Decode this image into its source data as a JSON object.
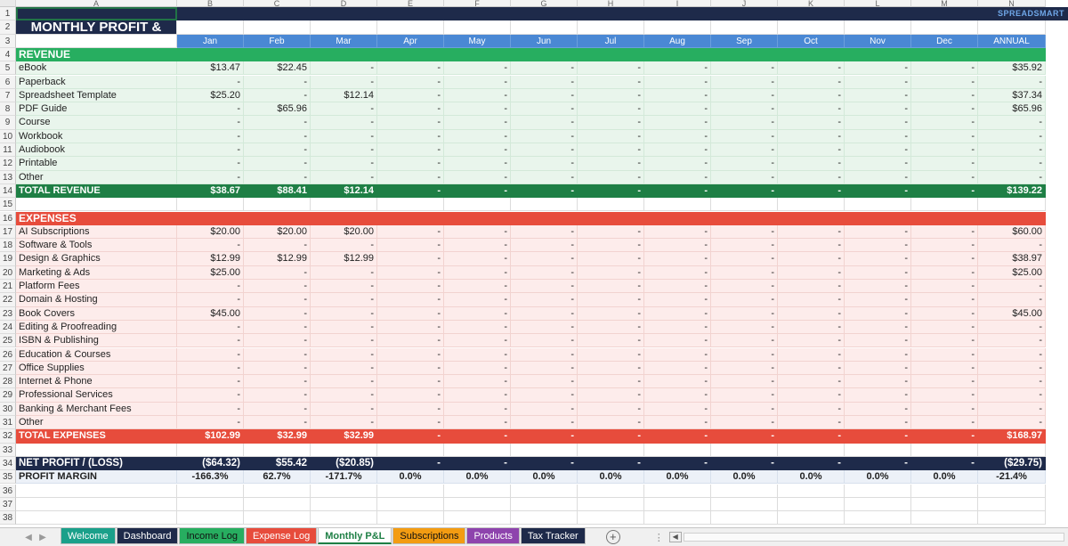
{
  "brand": "SPREADSMART",
  "title": "MONTHLY PROFIT &",
  "column_letters": [
    "A",
    "B",
    "C",
    "D",
    "E",
    "F",
    "G",
    "H",
    "I",
    "J",
    "K",
    "L",
    "M",
    "N"
  ],
  "months": [
    "Jan",
    "Feb",
    "Mar",
    "Apr",
    "May",
    "Jun",
    "Jul",
    "Aug",
    "Sep",
    "Oct",
    "Nov",
    "Dec",
    "ANNUAL"
  ],
  "revenue": {
    "header": "REVENUE",
    "items": [
      {
        "label": "eBook",
        "values": [
          "$13.47",
          "$22.45",
          "-",
          "-",
          "-",
          "-",
          "-",
          "-",
          "-",
          "-",
          "-",
          "-",
          "$35.92"
        ]
      },
      {
        "label": "Paperback",
        "values": [
          "-",
          "-",
          "-",
          "-",
          "-",
          "-",
          "-",
          "-",
          "-",
          "-",
          "-",
          "-",
          "-"
        ]
      },
      {
        "label": "Spreadsheet Template",
        "values": [
          "$25.20",
          "-",
          "$12.14",
          "-",
          "-",
          "-",
          "-",
          "-",
          "-",
          "-",
          "-",
          "-",
          "$37.34"
        ]
      },
      {
        "label": "PDF Guide",
        "values": [
          "-",
          "$65.96",
          "-",
          "-",
          "-",
          "-",
          "-",
          "-",
          "-",
          "-",
          "-",
          "-",
          "$65.96"
        ]
      },
      {
        "label": "Course",
        "values": [
          "-",
          "-",
          "-",
          "-",
          "-",
          "-",
          "-",
          "-",
          "-",
          "-",
          "-",
          "-",
          "-"
        ]
      },
      {
        "label": "Workbook",
        "values": [
          "-",
          "-",
          "-",
          "-",
          "-",
          "-",
          "-",
          "-",
          "-",
          "-",
          "-",
          "-",
          "-"
        ]
      },
      {
        "label": "Audiobook",
        "values": [
          "-",
          "-",
          "-",
          "-",
          "-",
          "-",
          "-",
          "-",
          "-",
          "-",
          "-",
          "-",
          "-"
        ]
      },
      {
        "label": "Printable",
        "values": [
          "-",
          "-",
          "-",
          "-",
          "-",
          "-",
          "-",
          "-",
          "-",
          "-",
          "-",
          "-",
          "-"
        ]
      },
      {
        "label": "Other",
        "values": [
          "-",
          "-",
          "-",
          "-",
          "-",
          "-",
          "-",
          "-",
          "-",
          "-",
          "-",
          "-",
          "-"
        ]
      }
    ],
    "total": {
      "label": "TOTAL REVENUE",
      "values": [
        "$38.67",
        "$88.41",
        "$12.14",
        "-",
        "-",
        "-",
        "-",
        "-",
        "-",
        "-",
        "-",
        "-",
        "$139.22"
      ]
    }
  },
  "expenses": {
    "header": "EXPENSES",
    "items": [
      {
        "label": "AI Subscriptions",
        "values": [
          "$20.00",
          "$20.00",
          "$20.00",
          "-",
          "-",
          "-",
          "-",
          "-",
          "-",
          "-",
          "-",
          "-",
          "$60.00"
        ]
      },
      {
        "label": "Software & Tools",
        "values": [
          "-",
          "-",
          "-",
          "-",
          "-",
          "-",
          "-",
          "-",
          "-",
          "-",
          "-",
          "-",
          "-"
        ]
      },
      {
        "label": "Design & Graphics",
        "values": [
          "$12.99",
          "$12.99",
          "$12.99",
          "-",
          "-",
          "-",
          "-",
          "-",
          "-",
          "-",
          "-",
          "-",
          "$38.97"
        ]
      },
      {
        "label": "Marketing & Ads",
        "values": [
          "$25.00",
          "-",
          "-",
          "-",
          "-",
          "-",
          "-",
          "-",
          "-",
          "-",
          "-",
          "-",
          "$25.00"
        ]
      },
      {
        "label": "Platform Fees",
        "values": [
          "-",
          "-",
          "-",
          "-",
          "-",
          "-",
          "-",
          "-",
          "-",
          "-",
          "-",
          "-",
          "-"
        ]
      },
      {
        "label": "Domain & Hosting",
        "values": [
          "-",
          "-",
          "-",
          "-",
          "-",
          "-",
          "-",
          "-",
          "-",
          "-",
          "-",
          "-",
          "-"
        ]
      },
      {
        "label": "Book Covers",
        "values": [
          "$45.00",
          "-",
          "-",
          "-",
          "-",
          "-",
          "-",
          "-",
          "-",
          "-",
          "-",
          "-",
          "$45.00"
        ]
      },
      {
        "label": "Editing & Proofreading",
        "values": [
          "-",
          "-",
          "-",
          "-",
          "-",
          "-",
          "-",
          "-",
          "-",
          "-",
          "-",
          "-",
          "-"
        ]
      },
      {
        "label": "ISBN & Publishing",
        "values": [
          "-",
          "-",
          "-",
          "-",
          "-",
          "-",
          "-",
          "-",
          "-",
          "-",
          "-",
          "-",
          "-"
        ]
      },
      {
        "label": "Education & Courses",
        "values": [
          "-",
          "-",
          "-",
          "-",
          "-",
          "-",
          "-",
          "-",
          "-",
          "-",
          "-",
          "-",
          "-"
        ]
      },
      {
        "label": "Office Supplies",
        "values": [
          "-",
          "-",
          "-",
          "-",
          "-",
          "-",
          "-",
          "-",
          "-",
          "-",
          "-",
          "-",
          "-"
        ]
      },
      {
        "label": "Internet & Phone",
        "values": [
          "-",
          "-",
          "-",
          "-",
          "-",
          "-",
          "-",
          "-",
          "-",
          "-",
          "-",
          "-",
          "-"
        ]
      },
      {
        "label": "Professional Services",
        "values": [
          "-",
          "-",
          "-",
          "-",
          "-",
          "-",
          "-",
          "-",
          "-",
          "-",
          "-",
          "-",
          "-"
        ]
      },
      {
        "label": "Banking & Merchant Fees",
        "values": [
          "-",
          "-",
          "-",
          "-",
          "-",
          "-",
          "-",
          "-",
          "-",
          "-",
          "-",
          "-",
          "-"
        ]
      },
      {
        "label": "Other",
        "values": [
          "-",
          "-",
          "-",
          "-",
          "-",
          "-",
          "-",
          "-",
          "-",
          "-",
          "-",
          "-",
          "-"
        ]
      }
    ],
    "total": {
      "label": "TOTAL EXPENSES",
      "values": [
        "$102.99",
        "$32.99",
        "$32.99",
        "-",
        "-",
        "-",
        "-",
        "-",
        "-",
        "-",
        "-",
        "-",
        "$168.97"
      ]
    }
  },
  "net_profit": {
    "label": "NET PROFIT / (LOSS)",
    "values": [
      "($64.32)",
      "$55.42",
      "($20.85)",
      "-",
      "-",
      "-",
      "-",
      "-",
      "-",
      "-",
      "-",
      "-",
      "($29.75)"
    ]
  },
  "profit_margin": {
    "label": "PROFIT MARGIN",
    "values": [
      "-166.3%",
      "62.7%",
      "-171.7%",
      "0.0%",
      "0.0%",
      "0.0%",
      "0.0%",
      "0.0%",
      "0.0%",
      "0.0%",
      "0.0%",
      "0.0%",
      "-21.4%"
    ]
  },
  "tabs": [
    {
      "label": "Welcome",
      "color": "#1aa08a",
      "text": "#ffffff",
      "active": false
    },
    {
      "label": "Dashboard",
      "color": "#1e2a4a",
      "text": "#ffffff",
      "active": false
    },
    {
      "label": "Income Log",
      "color": "#27ae60",
      "text": "#111111",
      "active": false
    },
    {
      "label": "Expense Log",
      "color": "#e74c3c",
      "text": "#ffffff",
      "active": false
    },
    {
      "label": "Monthly P&L",
      "color": "#ffffff",
      "text": "#1e7f45",
      "active": true
    },
    {
      "label": "Subscriptions",
      "color": "#f39c12",
      "text": "#111111",
      "active": false
    },
    {
      "label": "Products",
      "color": "#8e44ad",
      "text": "#ffffff",
      "active": false
    },
    {
      "label": "Tax Tracker",
      "color": "#1e2a4a",
      "text": "#ffffff",
      "active": false
    }
  ],
  "add_sheet_symbol": "+",
  "nav_prev_symbol": "◀",
  "nav_next_symbol": "▶"
}
